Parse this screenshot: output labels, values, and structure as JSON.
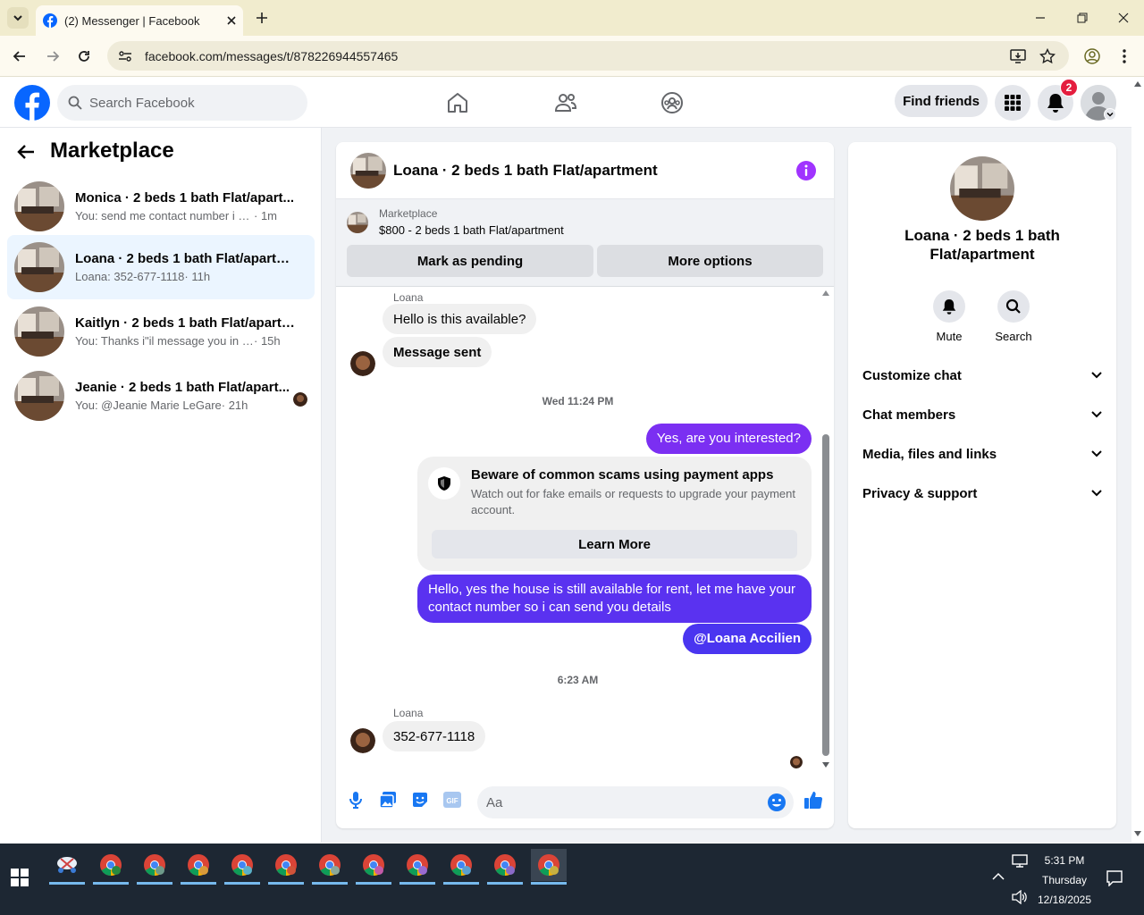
{
  "browser": {
    "tab_title": "(2) Messenger | Facebook",
    "url": "facebook.com/messages/t/878226944557465"
  },
  "header": {
    "search_placeholder": "Search Facebook",
    "find_friends": "Find friends",
    "notification_count": "2"
  },
  "left": {
    "title": "Marketplace",
    "conversations": [
      {
        "name": "Monica · 2 beds 1 bath Flat/apart...",
        "preview": "You: send me contact number i send ...",
        "time": "· 1m",
        "active": false
      },
      {
        "name": "Loana · 2 beds 1 bath Flat/apartme...",
        "preview": "Loana: 352-677-1118",
        "time": "· 11h",
        "active": true
      },
      {
        "name": "Kaitlyn · 2 beds 1 bath Flat/apartm...",
        "preview": "You: Thanks i\"il message you in a m...",
        "time": "· 15h",
        "active": false
      },
      {
        "name": "Jeanie · 2 beds 1 bath Flat/apart...",
        "preview": "You: @Jeanie Marie LeGare",
        "time": "· 21h",
        "active": false
      }
    ]
  },
  "chat": {
    "title": "Loana · 2 beds 1 bath Flat/apartment",
    "listing": {
      "source": "Marketplace",
      "title": "$800 - 2 beds 1 bath Flat/apartment",
      "mark_pending": "Mark as pending",
      "more_options": "More options"
    },
    "messages": {
      "sender1": "Loana",
      "in1": "Hello is this available?",
      "in2": "Message sent",
      "ts1": "Wed 11:24 PM",
      "out1": "Yes, are you interested?",
      "scam_title": "Beware of common scams using payment apps",
      "scam_desc": "Watch out for fake emails or requests to upgrade your payment account.",
      "learn_more": "Learn More",
      "out2": "Hello, yes the house is still available for rent, let me have your contact number so i can send you details",
      "out3": "@Loana Accilien",
      "ts2": "6:23 AM",
      "sender2": "Loana",
      "in3": "352-677-1118"
    },
    "composer_placeholder": "Aa",
    "colors": {
      "accent": "#a033ff",
      "out_purple": "#7b2ff2",
      "out_blue": "#4a35f0"
    }
  },
  "info": {
    "name": "Loana · 2 beds 1 bath Flat/apartment",
    "mute": "Mute",
    "search": "Search",
    "sections": [
      "Customize chat",
      "Chat members",
      "Media, files and links",
      "Privacy & support"
    ]
  },
  "taskbar": {
    "time": "5:31 PM",
    "day": "Thursday",
    "date": "12/18/2025"
  }
}
